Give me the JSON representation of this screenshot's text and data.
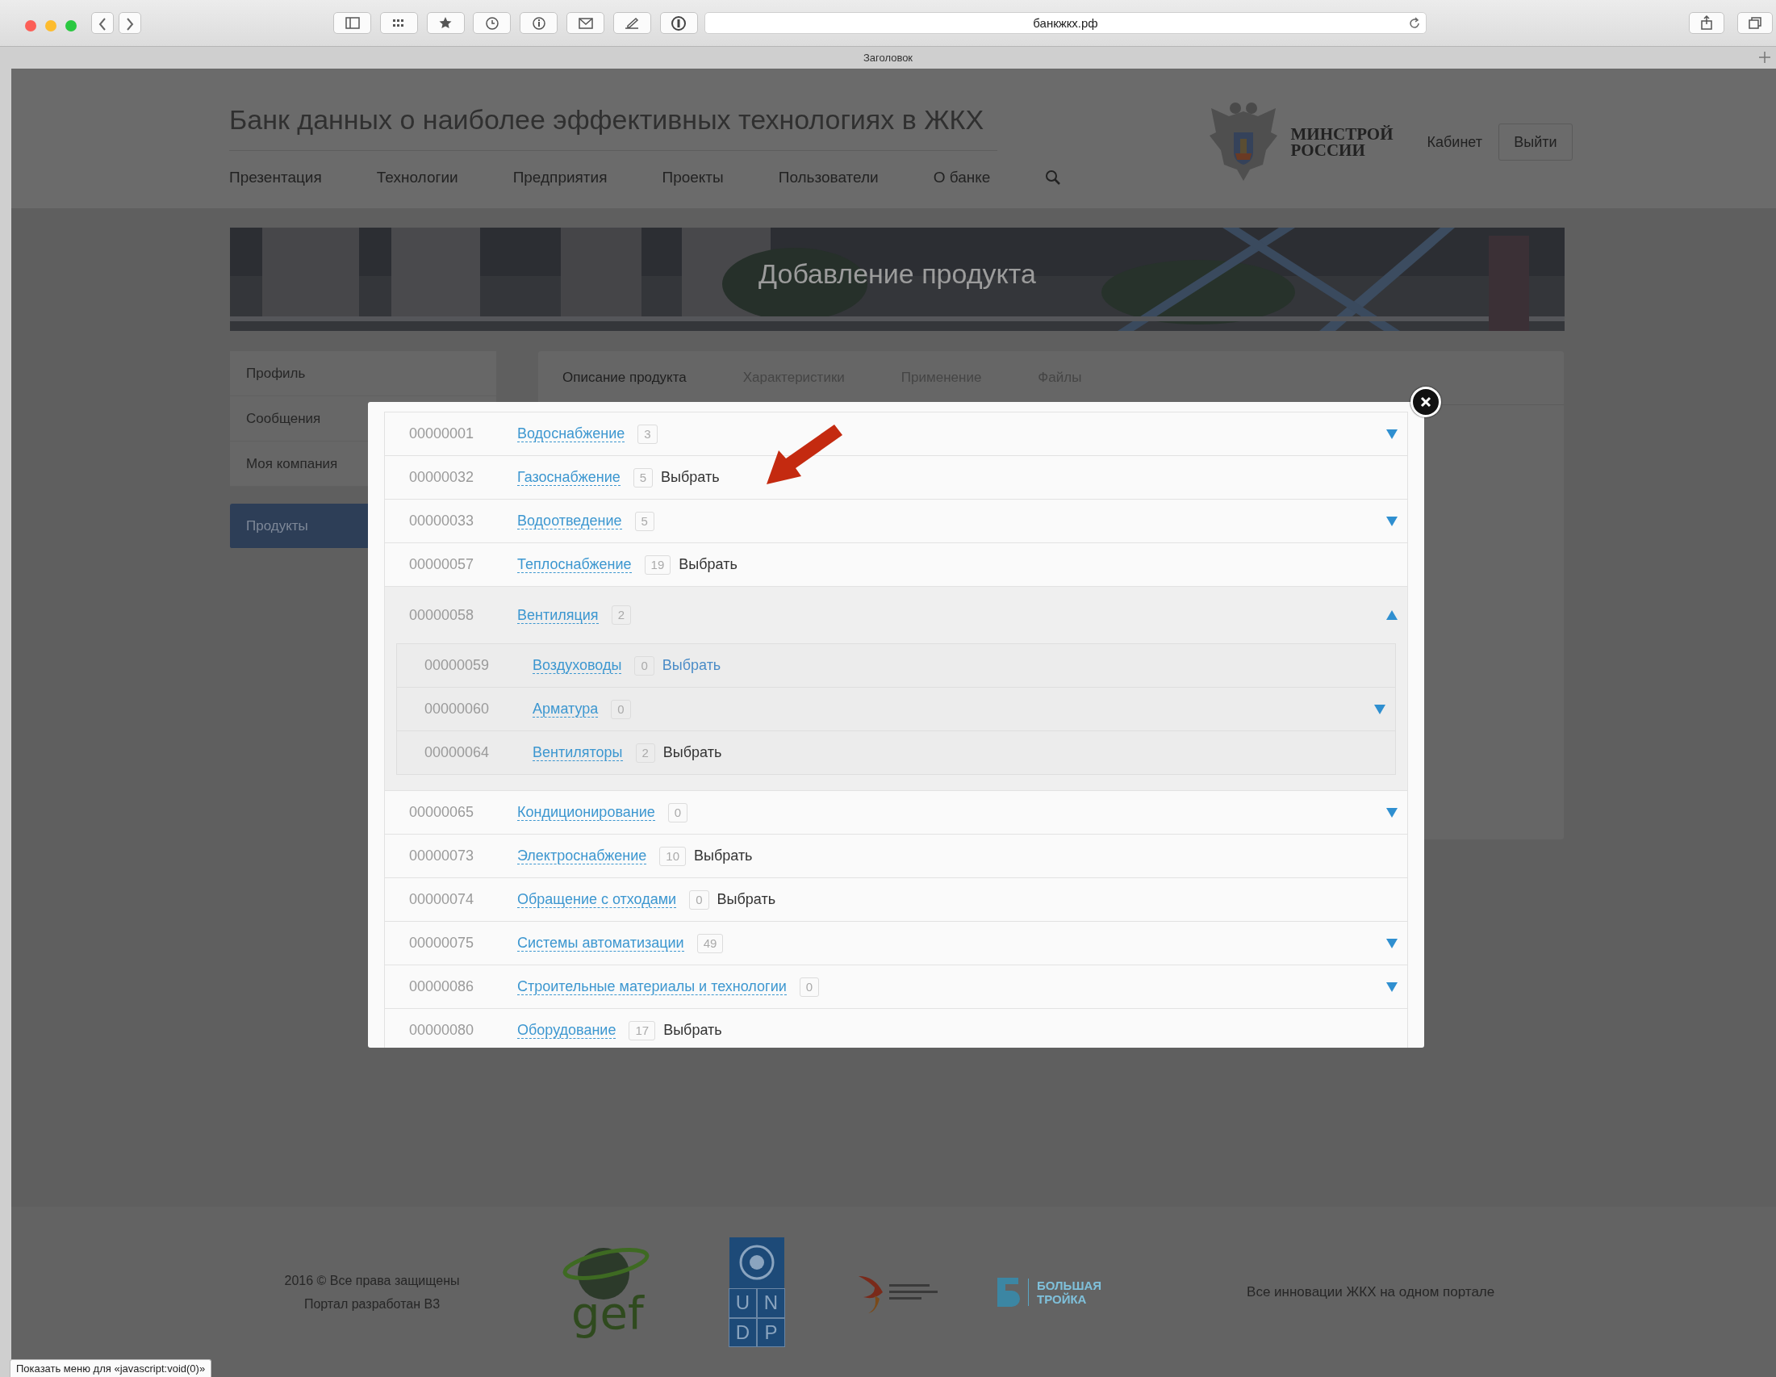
{
  "browser": {
    "address": "банкжкх.рф",
    "tab_title": "Заголовок"
  },
  "header": {
    "title": "Банк данных о наиболее эффективных технологиях в ЖКХ",
    "nav": [
      "Презентация",
      "Технологии",
      "Предприятия",
      "Проекты",
      "Пользователи",
      "О банке"
    ],
    "ministry": [
      "МИНСТРОЙ",
      "РОССИИ"
    ],
    "cabinet": "Кабинет",
    "logout": "Выйти"
  },
  "banner": {
    "title": "Добавление продукта"
  },
  "sidebar": {
    "items": [
      {
        "label": "Профиль",
        "selected": false
      },
      {
        "label": "Сообщения",
        "selected": false
      },
      {
        "label": "Моя компания",
        "selected": false
      },
      {
        "label": "Продукты",
        "selected": true
      }
    ]
  },
  "tabs": [
    {
      "label": "Описание продукта",
      "selected": true
    },
    {
      "label": "Характеристики",
      "selected": false
    },
    {
      "label": "Применение",
      "selected": false
    },
    {
      "label": "Файлы",
      "selected": false
    }
  ],
  "category_dialog": {
    "rows": [
      {
        "kind": "group",
        "code": "00000001",
        "name": "Водоснабжение",
        "count": "3",
        "expanded": false
      },
      {
        "kind": "leaf",
        "code": "00000032",
        "name": "Газоснабжение",
        "count": "5",
        "action": "Выбрать",
        "hovered": false
      },
      {
        "kind": "group",
        "code": "00000033",
        "name": "Водоотведение",
        "count": "5",
        "expanded": false
      },
      {
        "kind": "leaf",
        "code": "00000057",
        "name": "Теплоснабжение",
        "count": "19",
        "action": "Выбрать",
        "hovered": false
      },
      {
        "kind": "group",
        "code": "00000058",
        "name": "Вентиляция",
        "count": "2",
        "expanded": true,
        "children": [
          {
            "kind": "leaf",
            "code": "00000059",
            "name": "Воздуховоды",
            "count": "0",
            "action": "Выбрать",
            "hovered": true
          },
          {
            "kind": "group",
            "code": "00000060",
            "name": "Арматура",
            "count": "0",
            "expanded": false
          },
          {
            "kind": "leaf",
            "code": "00000064",
            "name": "Вентиляторы",
            "count": "2",
            "action": "Выбрать",
            "hovered": false
          }
        ]
      },
      {
        "kind": "group",
        "code": "00000065",
        "name": "Кондиционирование",
        "count": "0",
        "expanded": false
      },
      {
        "kind": "leaf",
        "code": "00000073",
        "name": "Электроснабжение",
        "count": "10",
        "action": "Выбрать",
        "hovered": false
      },
      {
        "kind": "leaf",
        "code": "00000074",
        "name": "Обращение с отходами",
        "count": "0",
        "action": "Выбрать",
        "hovered": false
      },
      {
        "kind": "group",
        "code": "00000075",
        "name": "Системы автоматизации",
        "count": "49",
        "expanded": false
      },
      {
        "kind": "group",
        "code": "00000086",
        "name": "Строительные материалы и технологии",
        "count": "0",
        "expanded": false
      },
      {
        "kind": "leaf",
        "code": "00000080",
        "name": "Оборудование",
        "count": "17",
        "action": "Выбрать",
        "hovered": false
      }
    ]
  },
  "footer": {
    "copyright": [
      "2016 © Все права защищены",
      "Портал разработан В3"
    ],
    "gef": "gef",
    "undp": [
      "U",
      "N",
      "D",
      "P"
    ],
    "troika": [
      "БОЛЬШАЯ",
      "ТРОЙКА"
    ],
    "tagline": "Все инновации ЖКХ на одном портале"
  },
  "status_bar": "Показать меню для «javascript:void(0)»"
}
